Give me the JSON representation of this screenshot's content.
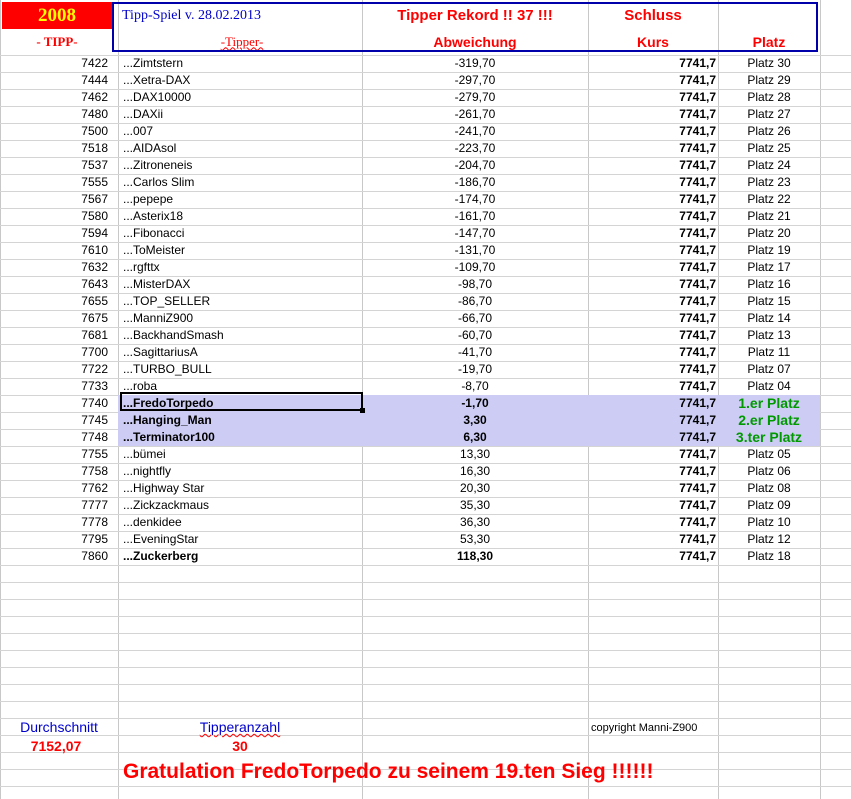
{
  "header": {
    "year": "2008",
    "tipp_label": "- TIPP-",
    "title": "Tipp-Spiel v. 28.02.2013",
    "tipper_label": "-Tipper-",
    "rekord": "Tipper Rekord !!  37  !!!",
    "abweichung_label": "Abweichung",
    "schluss": "Schluss",
    "kurs_label": "Kurs",
    "platz_label": "Platz"
  },
  "rows": [
    {
      "tipp": "7422",
      "name": "...Zimtstern",
      "abw": "-319,70",
      "kurs": "7741,7",
      "platz": "Platz 30"
    },
    {
      "tipp": "7444",
      "name": "...Xetra-DAX",
      "abw": "-297,70",
      "kurs": "7741,7",
      "platz": "Platz 29"
    },
    {
      "tipp": "7462",
      "name": "...DAX10000",
      "abw": "-279,70",
      "kurs": "7741,7",
      "platz": "Platz 28"
    },
    {
      "tipp": "7480",
      "name": "...DAXii",
      "abw": "-261,70",
      "kurs": "7741,7",
      "platz": "Platz 27"
    },
    {
      "tipp": "7500",
      "name": "...007",
      "abw": "-241,70",
      "kurs": "7741,7",
      "platz": "Platz 26"
    },
    {
      "tipp": "7518",
      "name": "...AIDAsol",
      "abw": "-223,70",
      "kurs": "7741,7",
      "platz": "Platz 25"
    },
    {
      "tipp": "7537",
      "name": "...Zitroneneis",
      "abw": "-204,70",
      "kurs": "7741,7",
      "platz": "Platz 24"
    },
    {
      "tipp": "7555",
      "name": "...Carlos Slim",
      "abw": "-186,70",
      "kurs": "7741,7",
      "platz": "Platz 23"
    },
    {
      "tipp": "7567",
      "name": "...pepepe",
      "abw": "-174,70",
      "kurs": "7741,7",
      "platz": "Platz 22"
    },
    {
      "tipp": "7580",
      "name": "...Asterix18",
      "abw": "-161,70",
      "kurs": "7741,7",
      "platz": "Platz 21"
    },
    {
      "tipp": "7594",
      "name": "...Fibonacci",
      "abw": "-147,70",
      "kurs": "7741,7",
      "platz": "Platz 20"
    },
    {
      "tipp": "7610",
      "name": "...ToMeister",
      "abw": "-131,70",
      "kurs": "7741,7",
      "platz": "Platz 19"
    },
    {
      "tipp": "7632",
      "name": "...rgfttx",
      "abw": "-109,70",
      "kurs": "7741,7",
      "platz": "Platz 17"
    },
    {
      "tipp": "7643",
      "name": "...MisterDAX",
      "abw": "-98,70",
      "kurs": "7741,7",
      "platz": "Platz 16"
    },
    {
      "tipp": "7655",
      "name": "...TOP_SELLER",
      "abw": "-86,70",
      "kurs": "7741,7",
      "platz": "Platz 15"
    },
    {
      "tipp": "7675",
      "name": "...ManniZ900",
      "abw": "-66,70",
      "kurs": "7741,7",
      "platz": "Platz 14"
    },
    {
      "tipp": "7681",
      "name": "...BackhandSmash",
      "abw": "-60,70",
      "kurs": "7741,7",
      "platz": "Platz 13"
    },
    {
      "tipp": "7700",
      "name": "...SagittariusA",
      "abw": "-41,70",
      "kurs": "7741,7",
      "platz": "Platz 11"
    },
    {
      "tipp": "7722",
      "name": "...TURBO_BULL",
      "abw": "-19,70",
      "kurs": "7741,7",
      "platz": "Platz 07"
    },
    {
      "tipp": "7733",
      "name": "...roba",
      "abw": "-8,70",
      "kurs": "7741,7",
      "platz": "Platz 04"
    },
    {
      "tipp": "7740",
      "name": "...FredoTorpedo",
      "abw": "-1,70",
      "kurs": "7741,7",
      "platz": "1.er Platz",
      "highlight": true
    },
    {
      "tipp": "7745",
      "name": "...Hanging_Man",
      "abw": "3,30",
      "kurs": "7741,7",
      "platz": "2.er Platz",
      "highlight": true
    },
    {
      "tipp": "7748",
      "name": "...Terminator100",
      "abw": "6,30",
      "kurs": "7741,7",
      "platz": "3.ter Platz",
      "highlight": true
    },
    {
      "tipp": "7755",
      "name": "...bümei",
      "abw": "13,30",
      "kurs": "7741,7",
      "platz": "Platz 05"
    },
    {
      "tipp": "7758",
      "name": "...nightfly",
      "abw": "16,30",
      "kurs": "7741,7",
      "platz": "Platz 06"
    },
    {
      "tipp": "7762",
      "name": "...Highway Star",
      "abw": "20,30",
      "kurs": "7741,7",
      "platz": "Platz 08"
    },
    {
      "tipp": "7777",
      "name": "...Zickzackmaus",
      "abw": "35,30",
      "kurs": "7741,7",
      "platz": "Platz 09"
    },
    {
      "tipp": "7778",
      "name": "...denkidee",
      "abw": "36,30",
      "kurs": "7741,7",
      "platz": "Platz 10"
    },
    {
      "tipp": "7795",
      "name": "...EveningStar",
      "abw": "53,30",
      "kurs": "7741,7",
      "platz": "Platz 12"
    },
    {
      "tipp": "7860",
      "name": "...Zuckerberg",
      "abw": "118,30",
      "kurs": "7741,7",
      "platz": "Platz 18",
      "last": true
    }
  ],
  "footer": {
    "avg_label": "Durchschnitt",
    "avg_value": "7152,07",
    "count_label": "Tipperanzahl",
    "count_value": "30",
    "copyright": "copyright Manni-Z900",
    "congrats": "Gratulation FredoTorpedo  zu seinem 19.ten Sieg !!!!!!"
  },
  "colors": {
    "accent_red": "#ff0000",
    "title_blue": "#0000cc",
    "year_text": "#ffff00",
    "highlight_bg": "#ccccf5",
    "winner_green": "#009900"
  }
}
